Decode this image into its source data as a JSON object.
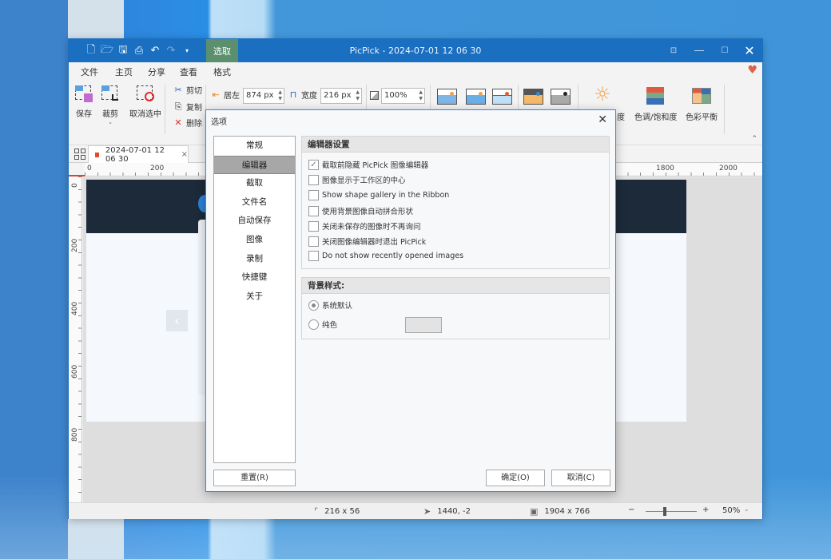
{
  "window": {
    "title": "PicPick - 2024-07-01 12 06 30",
    "context_tab": "选取",
    "quick_access": [
      "new-icon",
      "open-icon",
      "save-icon",
      "print-icon",
      "undo-icon",
      "redo-icon",
      "dropdown-icon"
    ],
    "controls": [
      "capture-icon",
      "minimize-icon",
      "maximize-icon",
      "close-icon"
    ]
  },
  "menu": {
    "items": [
      {
        "label": "文件"
      },
      {
        "label": "主页"
      },
      {
        "label": "分享"
      },
      {
        "label": "查看"
      },
      {
        "label": "格式",
        "active": true
      }
    ]
  },
  "ribbon": {
    "save": "保存",
    "crop": "裁剪",
    "deselect": "取消选中",
    "cut": "剪切",
    "copy": "复制",
    "delete": "删除",
    "left_label": "居左",
    "left_value": "874 px",
    "width_label": "宽度",
    "width_value": "216 px",
    "zoom_value": "100%",
    "brightness_partial": "度",
    "hue_saturation": "色调/饱和度",
    "color_balance": "色彩平衡",
    "accent_color": "#1a6fc0"
  },
  "doc_tab": {
    "label": "2024-07-01 12 06 30",
    "close": "×"
  },
  "rulers": {
    "h_labels": [
      "0",
      "200",
      "1800",
      "2000"
    ],
    "v_labels": [
      "0",
      "200",
      "400",
      "600",
      "800"
    ]
  },
  "status": {
    "selection_size": "216 x 56",
    "cursor_pos": "1440, -2",
    "image_size": "1904 x 766",
    "zoom": "50%",
    "zoom_slider_fraction": 0.37
  },
  "dialog": {
    "title": "选项",
    "nav": [
      {
        "label": "常规"
      },
      {
        "label": "编辑器",
        "selected": true
      },
      {
        "label": "截取"
      },
      {
        "label": "文件名"
      },
      {
        "label": "自动保存"
      },
      {
        "label": "图像"
      },
      {
        "label": "录制"
      },
      {
        "label": "快捷键"
      },
      {
        "label": "关于"
      }
    ],
    "editor_group": {
      "title": "编辑器设置",
      "options": [
        {
          "label": "截取前隐藏 PicPick 图像编辑器",
          "checked": true
        },
        {
          "label": "图像显示于工作区的中心",
          "checked": false
        },
        {
          "label": "Show shape gallery in the Ribbon",
          "checked": false
        },
        {
          "label": "使用背景图像自动拼合形状",
          "checked": false
        },
        {
          "label": "关闭未保存的图像时不再询问",
          "checked": false
        },
        {
          "label": "关闭图像编辑器时退出 PicPick",
          "checked": false
        },
        {
          "label": "Do not show recently opened images",
          "checked": false
        }
      ]
    },
    "background_group": {
      "title": "背景样式:",
      "options": [
        {
          "label": "系统默认",
          "selected": true
        },
        {
          "label": "纯色",
          "selected": false
        }
      ],
      "solid_color": "#e3e3e3"
    },
    "buttons": {
      "reset": "重置(R)",
      "ok": "确定(O)",
      "cancel": "取消(C)"
    }
  }
}
